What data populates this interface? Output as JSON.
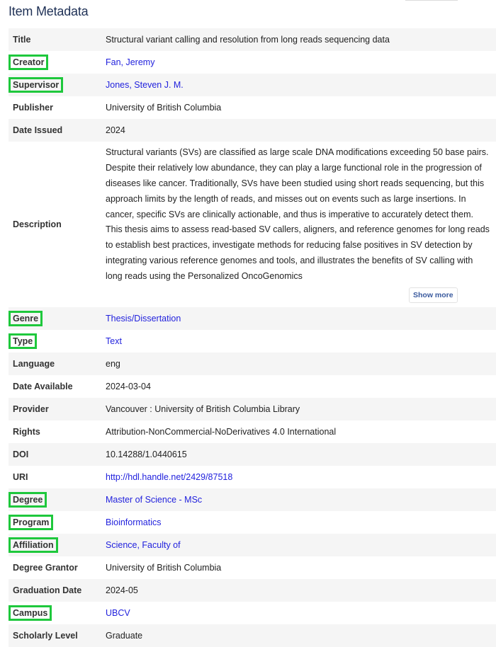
{
  "page": {
    "title": "Item Metadata"
  },
  "rows": [
    {
      "label": "Title",
      "value": "Structural variant calling and resolution from long reads sequencing data",
      "link": false,
      "highlighted": false
    },
    {
      "label": "Creator",
      "value": "Fan, Jeremy",
      "link": true,
      "highlighted": true
    },
    {
      "label": "Supervisor",
      "value": "Jones, Steven J. M.",
      "link": true,
      "highlighted": true
    },
    {
      "label": "Publisher",
      "value": "University of British Columbia",
      "link": false,
      "highlighted": false
    },
    {
      "label": "Date Issued",
      "value": "2024",
      "link": false,
      "highlighted": false
    },
    {
      "label": "Description",
      "value": "Structural variants (SVs) are classified as large scale DNA modifications exceeding 50 base pairs. Despite their relatively low abundance, they can play a large functional role in the progression of diseases like cancer. Traditionally, SVs have been studied using short reads sequencing, but this approach limits by the length of reads, and misses out on events such as large insertions. In cancer, specific SVs are clinically actionable, and thus is imperative to accurately detect them. This thesis aims to assess read-based SV callers, aligners, and reference genomes for long reads to establish best practices, investigate methods for reducing false positives in SV detection by integrating various reference genomes and tools, and illustrates the benefits of SV calling with long reads using the Personalized OncoGenomics",
      "link": false,
      "highlighted": false,
      "show_more_label": "Show more"
    },
    {
      "label": "Genre",
      "value": "Thesis/Dissertation",
      "link": true,
      "highlighted": true
    },
    {
      "label": "Type",
      "value": "Text",
      "link": true,
      "highlighted": true
    },
    {
      "label": "Language",
      "value": "eng",
      "link": false,
      "highlighted": false
    },
    {
      "label": "Date Available",
      "value": "2024-03-04",
      "link": false,
      "highlighted": false
    },
    {
      "label": "Provider",
      "value": "Vancouver : University of British Columbia Library",
      "link": false,
      "highlighted": false
    },
    {
      "label": "Rights",
      "value": "Attribution-NonCommercial-NoDerivatives 4.0 International",
      "link": false,
      "highlighted": false
    },
    {
      "label": "DOI",
      "value": "10.14288/1.0440615",
      "link": false,
      "highlighted": false
    },
    {
      "label": "URI",
      "value": "http://hdl.handle.net/2429/87518",
      "link": true,
      "highlighted": false
    },
    {
      "label": "Degree",
      "value": "Master of Science - MSc",
      "link": true,
      "highlighted": true
    },
    {
      "label": "Program",
      "value": "Bioinformatics",
      "link": true,
      "highlighted": true
    },
    {
      "label": "Affiliation",
      "value": "Science, Faculty of",
      "link": true,
      "highlighted": true
    },
    {
      "label": "Degree Grantor",
      "value": "University of British Columbia",
      "link": false,
      "highlighted": false
    },
    {
      "label": "Graduation Date",
      "value": "2024-05",
      "link": false,
      "highlighted": false
    },
    {
      "label": "Campus",
      "value": "UBCV",
      "link": true,
      "highlighted": true
    },
    {
      "label": "Scholarly Level",
      "value": "Graduate",
      "link": false,
      "highlighted": false
    }
  ],
  "colors": {
    "title": "#1f3156",
    "link": "#2222dd",
    "highlight_box": "#1ec83c",
    "row_alt": "#f5f5f5"
  }
}
